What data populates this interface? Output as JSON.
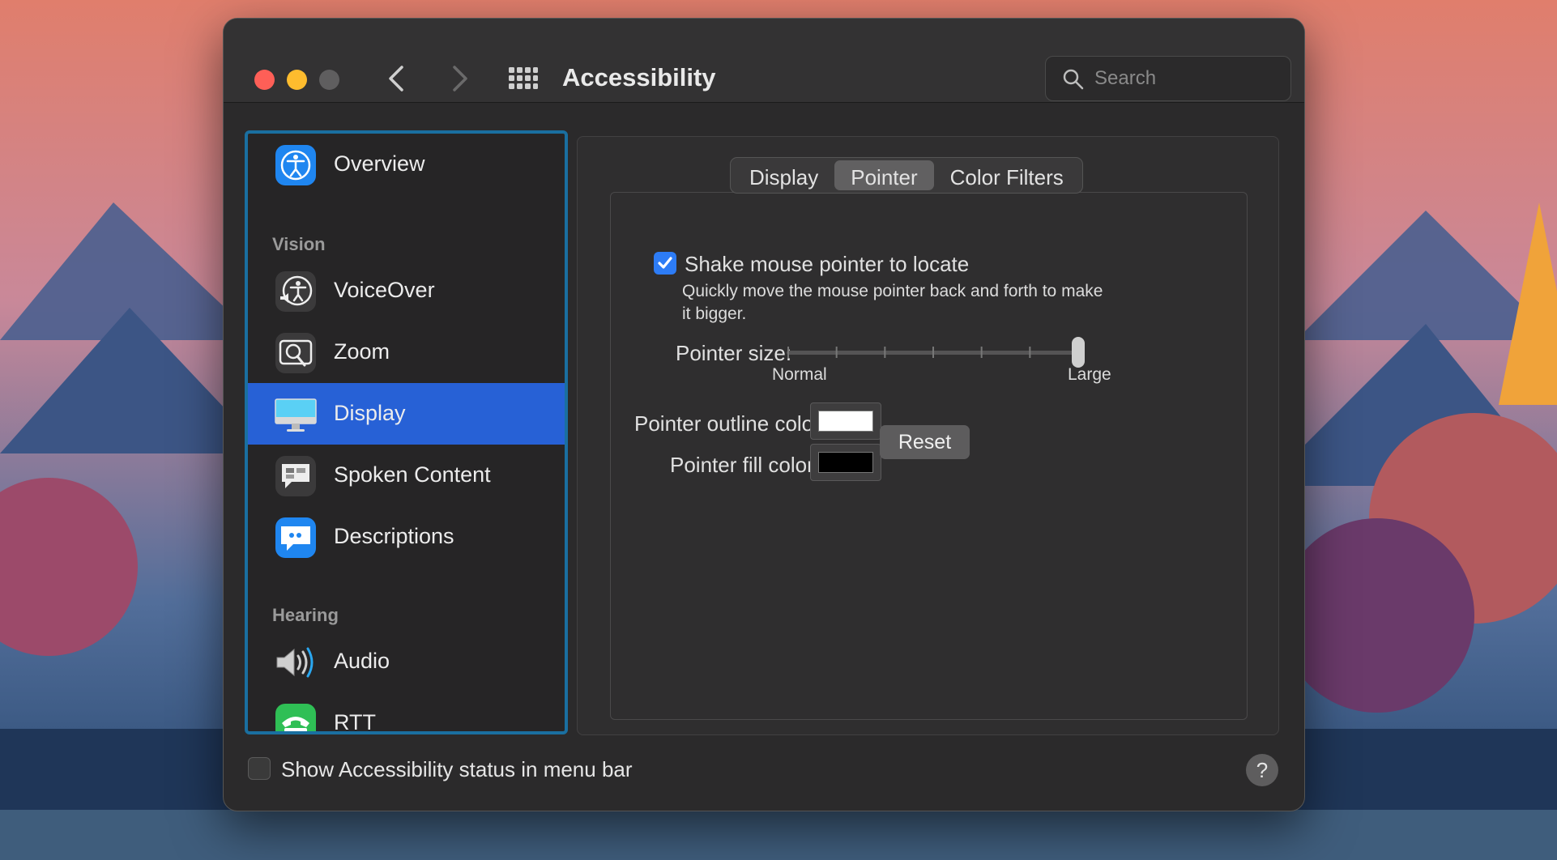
{
  "window": {
    "title": "Accessibility",
    "search_placeholder": "Search"
  },
  "sidebar": {
    "items": [
      {
        "label": "Overview",
        "icon": "overview-accessibility-icon"
      },
      {
        "label": "VoiceOver",
        "icon": "voiceover-icon"
      },
      {
        "label": "Zoom",
        "icon": "zoom-icon"
      },
      {
        "label": "Display",
        "icon": "display-monitor-icon",
        "selected": true
      },
      {
        "label": "Spoken Content",
        "icon": "spoken-content-icon"
      },
      {
        "label": "Descriptions",
        "icon": "descriptions-speech-bubble-icon"
      },
      {
        "label": "Audio",
        "icon": "audio-speaker-icon"
      },
      {
        "label": "RTT",
        "icon": "rtt-phone-icon"
      }
    ],
    "sections": {
      "vision": "Vision",
      "hearing": "Hearing"
    }
  },
  "tabs": [
    {
      "label": "Display",
      "active": false
    },
    {
      "label": "Pointer",
      "active": true
    },
    {
      "label": "Color Filters",
      "active": false
    }
  ],
  "pointer": {
    "shake_label": "Shake mouse pointer to locate",
    "shake_checked": true,
    "shake_desc_line1": "Quickly move the mouse pointer back and forth to make",
    "shake_desc_line2": "it bigger.",
    "size_label": "Pointer size:",
    "size_min_label": "Normal",
    "size_max_label": "Large",
    "size_value_fraction": 1.0,
    "outline_label": "Pointer outline color:",
    "outline_color": "#ffffff",
    "fill_label": "Pointer fill color:",
    "fill_color": "#000000",
    "reset_label": "Reset"
  },
  "footer": {
    "status_label": "Show Accessibility status in menu bar",
    "status_checked": false,
    "help_label": "?"
  },
  "colors": {
    "accent": "#2761d6",
    "sidebar_focus": "#1a6fa0",
    "close": "#fe5f57",
    "minimize": "#febc2e"
  }
}
